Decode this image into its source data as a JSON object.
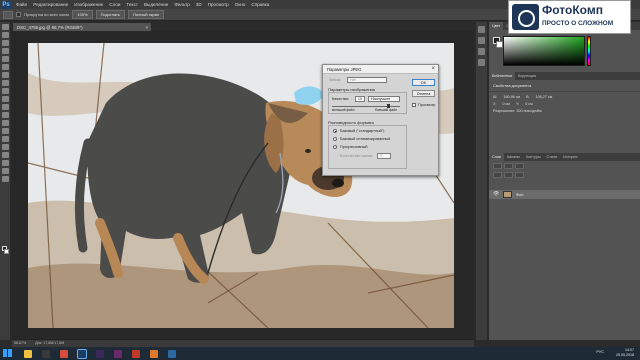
{
  "app": {
    "logo_text": "Ps",
    "menu": [
      "Файл",
      "Редактирование",
      "Изображение",
      "Слои",
      "Текст",
      "Выделение",
      "Фильтр",
      "3D",
      "Просмотр",
      "Окно",
      "Справка"
    ]
  },
  "options_bar": {
    "checkbox_label": "Прокрутка во всех окнах",
    "buttons": [
      "100%",
      "Подогнать",
      "Полный экран"
    ]
  },
  "document": {
    "tab_title": "DSC_4756.jpg @ 66,7% (RGB/8*)",
    "tab_close": "×",
    "zoom": "66,67%",
    "doc_info": "Док: 17,8M/17,8M"
  },
  "watermark": {
    "title": "ФотоКомп",
    "subtitle": "ПРОСТО О СЛОЖНОМ"
  },
  "panels": {
    "color_tabs": [
      "Цвет",
      "Образцы"
    ],
    "props_tabs": [
      "Библиотеки",
      "Коррекция"
    ],
    "props_title": "Свойства документа",
    "props_w_label": "Ш:",
    "props_w": "160,96 см",
    "props_h_label": "В:",
    "props_h": "106,27 см",
    "props_x_label": "X:",
    "props_x": "0 см",
    "props_y_label": "Y:",
    "props_y": "0 см",
    "props_res": "Разрешение: 300 пикс/дюйм",
    "layers_tabs": [
      "Слои",
      "Каналы",
      "Контуры",
      "Стили",
      "История"
    ],
    "layer_name": "Фон",
    "visibility_glyph": "👁"
  },
  "dialog": {
    "title": "Параметры JPEG",
    "close": "×",
    "matte_label": "Кайма:",
    "matte_value": "Нет",
    "image_options_label": "Параметры изображения",
    "quality_label": "Качество:",
    "quality_value": "10",
    "quality_preset": "Наилучшее",
    "quality_level": 0.83,
    "small_file": "меньший файл",
    "large_file": "больший файл",
    "format_options_label": "Разновидность формата",
    "format_options": [
      "Базовый (\"стандартный\")",
      "Базовый оптимизированный",
      "Прогрессивный"
    ],
    "scans_label": "Количество шагов:",
    "scans_value": "3",
    "ok_label": "OK",
    "cancel_label": "Отмена",
    "preview_label": "Просмотр"
  },
  "taskbar": {
    "lang": "РУС",
    "time": "14:07",
    "date": "25.05.2018"
  }
}
